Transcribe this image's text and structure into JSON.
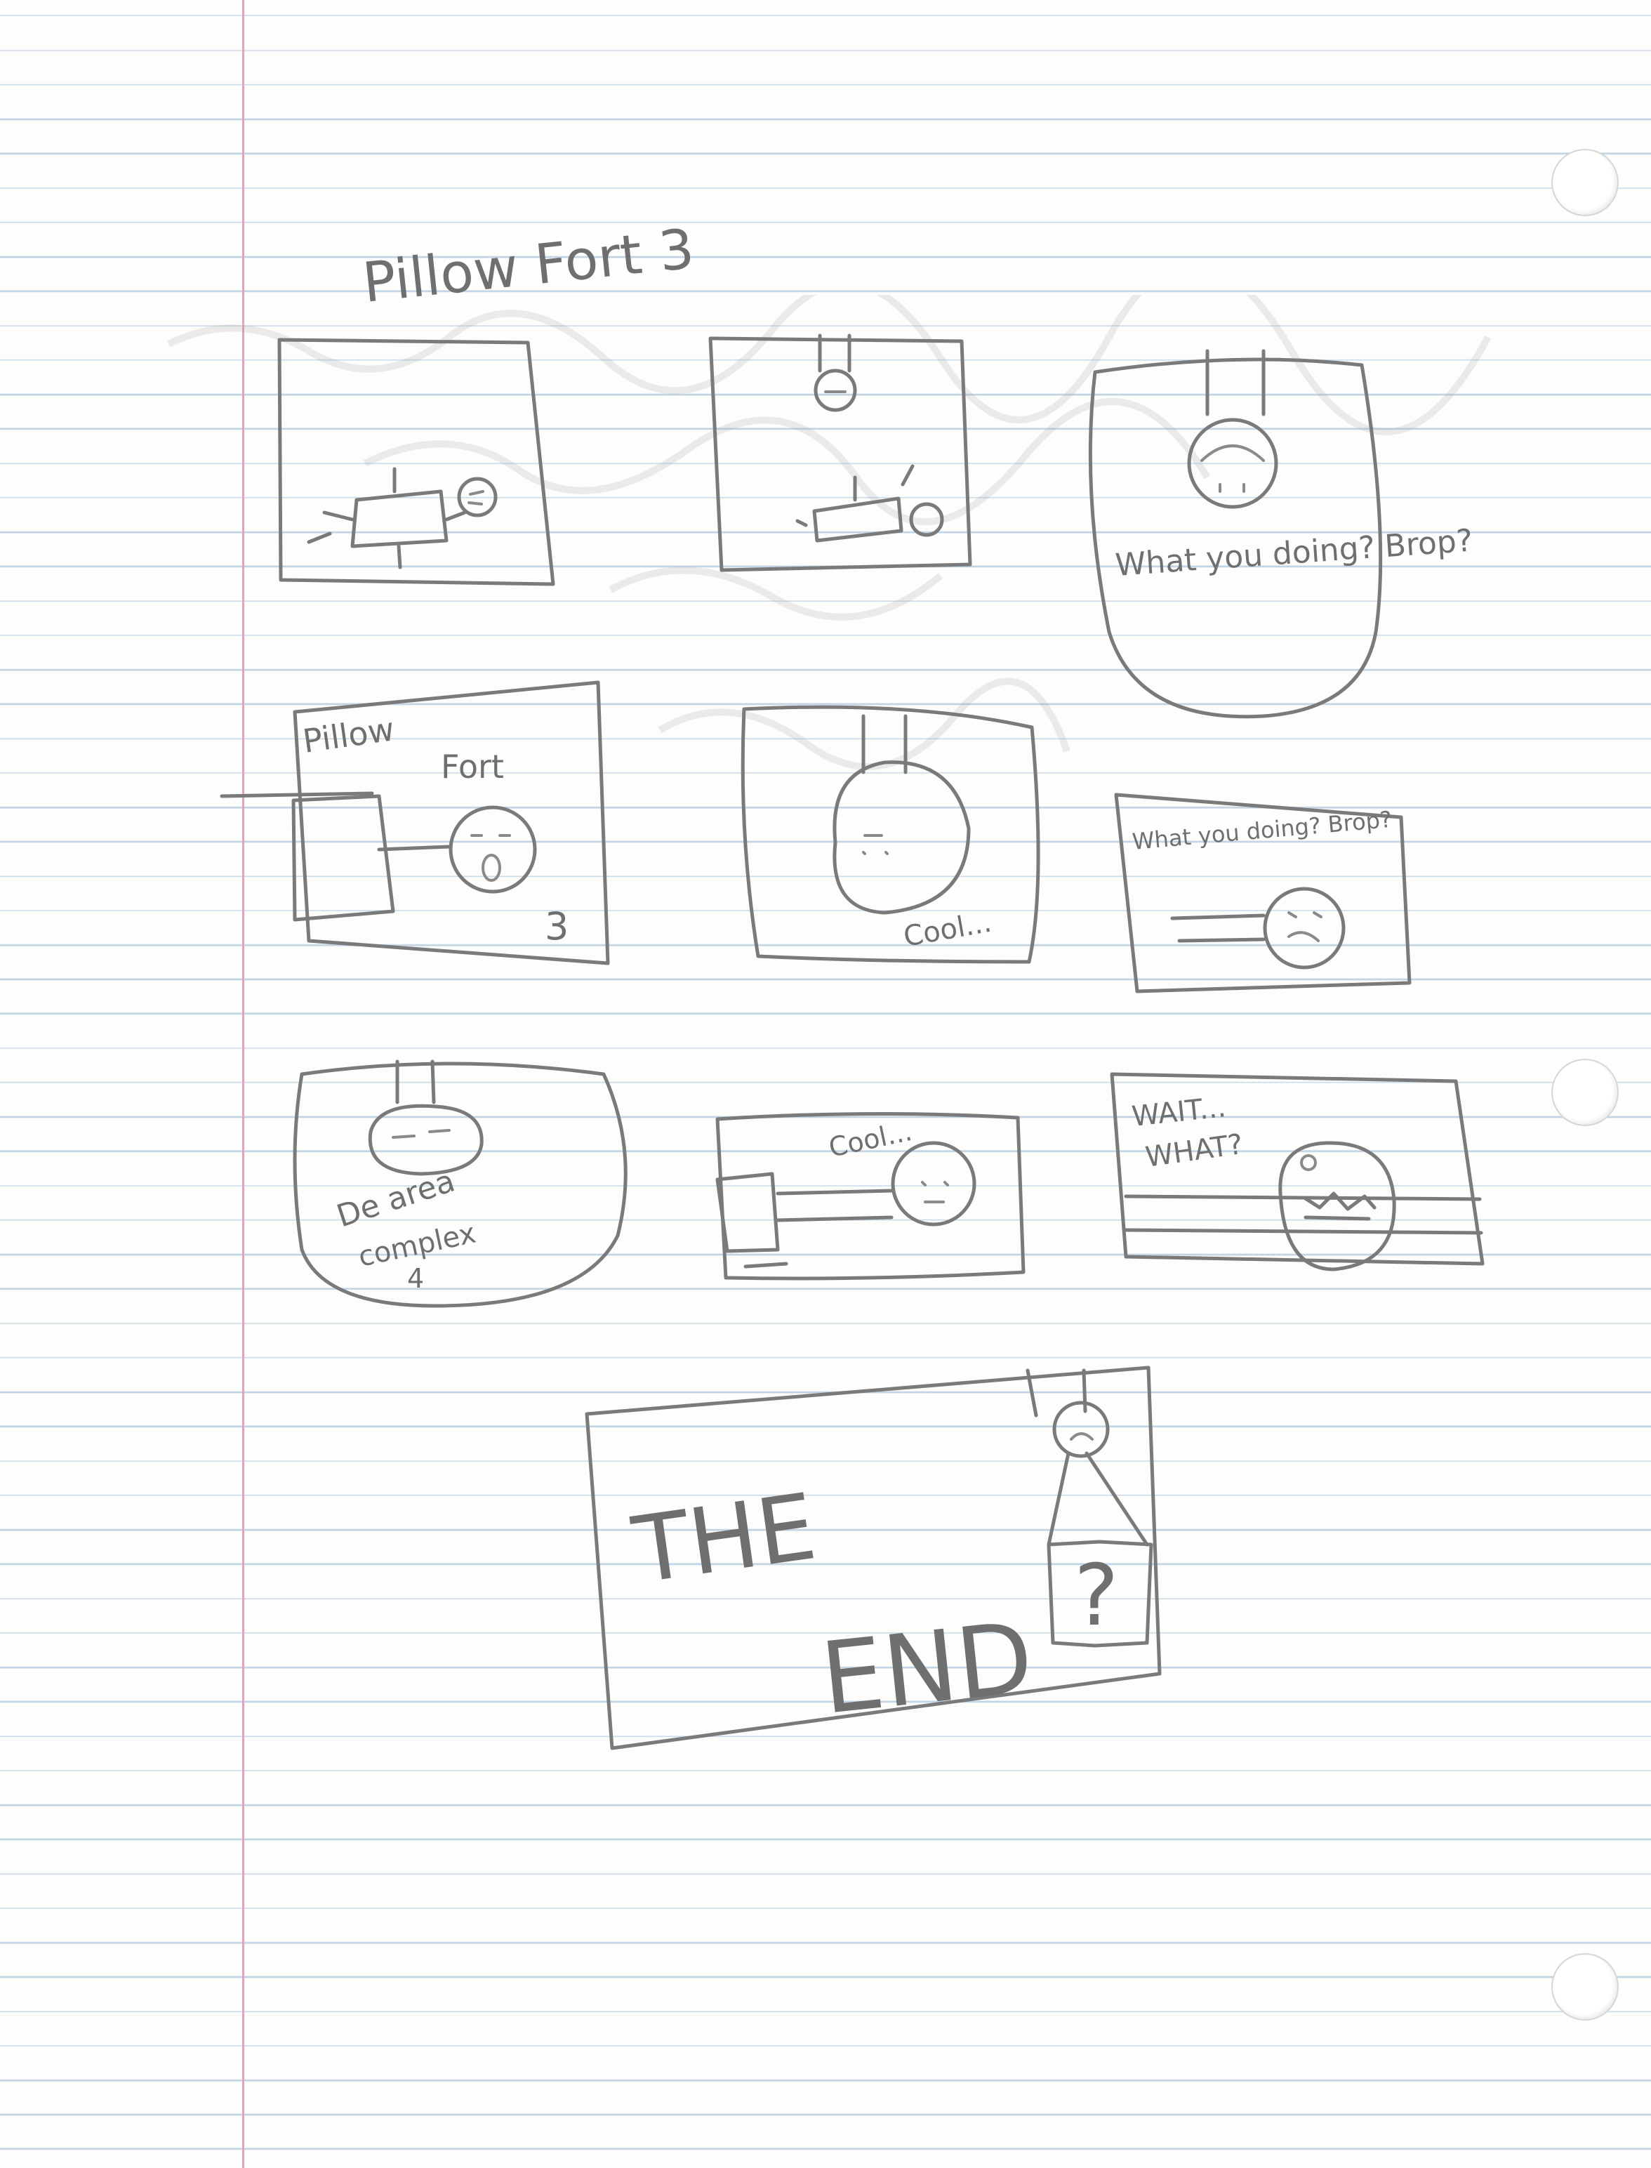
{
  "title": "Pillow Fort 3",
  "panels": {
    "p3_text": "What you doing? Brop?",
    "p4_text_1": "Pillow",
    "p4_text_2": "Fort",
    "p4_number": "3",
    "p5_text": "Cool...",
    "p6_text": "What you doing? Brop?",
    "p7_text_1": "De area",
    "p7_text_2": "complex",
    "p7_text_3": "4",
    "p8_text": "Cool...",
    "p9_text_1": "WAIT...",
    "p9_text_2": "WHAT?",
    "p10_text_1": "THE",
    "p10_text_2": "END",
    "p10_sign": "?"
  },
  "colors": {
    "pencil": "#7a7a7a",
    "ruled_line": "#bfd3e4",
    "margin": "#e7a0bd",
    "paper": "#fdfdfc"
  }
}
